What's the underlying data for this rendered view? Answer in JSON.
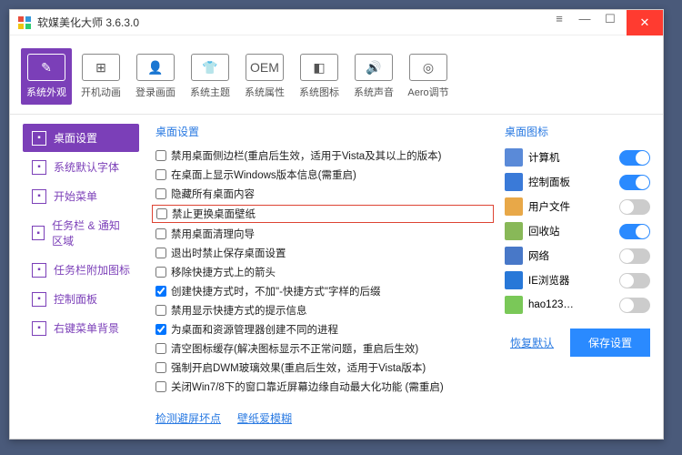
{
  "titlebar": {
    "title": "软媒美化大师 3.6.3.0"
  },
  "toolbar": [
    {
      "label": "系统外观",
      "icon": "✎"
    },
    {
      "label": "开机动画",
      "icon": "⊞"
    },
    {
      "label": "登录画面",
      "icon": "👤"
    },
    {
      "label": "系统主题",
      "icon": "👕"
    },
    {
      "label": "系统属性",
      "icon": "OEM"
    },
    {
      "label": "系统图标",
      "icon": "◧"
    },
    {
      "label": "系统声音",
      "icon": "🔊"
    },
    {
      "label": "Aero调节",
      "icon": "◎"
    }
  ],
  "sidebar": [
    "桌面设置",
    "系统默认字体",
    "开始菜单",
    "任务栏 & 通知区域",
    "任务栏附加图标",
    "控制面板",
    "右键菜单背景"
  ],
  "section": {
    "left": "桌面设置",
    "right": "桌面图标"
  },
  "checkboxes": [
    {
      "label": "禁用桌面侧边栏(重启后生效，适用于Vista及其以上的版本)",
      "checked": false
    },
    {
      "label": "在桌面上显示Windows版本信息(需重启)",
      "checked": false
    },
    {
      "label": "隐藏所有桌面内容",
      "checked": false
    },
    {
      "label": "禁止更换桌面壁纸",
      "checked": false,
      "highlight": true
    },
    {
      "label": "禁用桌面清理向导",
      "checked": false
    },
    {
      "label": "退出时禁止保存桌面设置",
      "checked": false
    },
    {
      "label": "移除快捷方式上的箭头",
      "checked": false
    },
    {
      "label": "创建快捷方式时，不加\"-快捷方式\"字样的后缀",
      "checked": true
    },
    {
      "label": "禁用显示快捷方式的提示信息",
      "checked": false
    },
    {
      "label": "为桌面和资源管理器创建不同的进程",
      "checked": true
    },
    {
      "label": "清空图标缓存(解决图标显示不正常问题，重启后生效)",
      "checked": false
    },
    {
      "label": "强制开启DWM玻璃效果(重启后生效，适用于Vista版本)",
      "checked": false
    },
    {
      "label": "关闭Win7/8下的窗口靠近屏幕边缘自动最大化功能 (需重启)",
      "checked": false
    }
  ],
  "links": {
    "check": "检测避屏坏点",
    "wallpaper": "壁纸爱模糊"
  },
  "icons": [
    {
      "label": "计算机",
      "on": true
    },
    {
      "label": "控制面板",
      "on": true
    },
    {
      "label": "用户文件",
      "on": false
    },
    {
      "label": "回收站",
      "on": true
    },
    {
      "label": "网络",
      "on": false
    },
    {
      "label": "IE浏览器",
      "on": false
    },
    {
      "label": "hao123…",
      "on": false
    }
  ],
  "footer": {
    "restore": "恢复默认",
    "save": "保存设置"
  }
}
